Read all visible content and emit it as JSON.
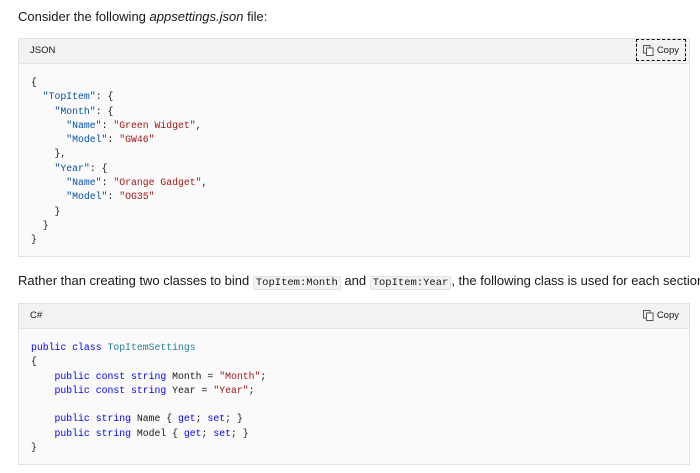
{
  "intro": {
    "prefix": "Consider the following ",
    "filename": "appsettings.json",
    "suffix": " file:"
  },
  "json_block": {
    "language": "JSON",
    "copy_label": "Copy",
    "lines": [
      "{",
      "  \"TopItem\": {",
      "    \"Month\": {",
      "      \"Name\": \"Green Widget\",",
      "      \"Model\": \"GW46\"",
      "    },",
      "    \"Year\": {",
      "      \"Name\": \"Orange Gadget\",",
      "      \"Model\": \"OG35\"",
      "    }",
      "  }",
      "}"
    ]
  },
  "middle": {
    "prefix": "Rather than creating two classes to bind ",
    "code1": "TopItem:Month",
    "and": " and ",
    "code2": "TopItem:Year",
    "suffix": ", the following class is used for each section:"
  },
  "csharp_block": {
    "language": "C#",
    "copy_label": "Copy",
    "lines": [
      "public class TopItemSettings",
      "{",
      "    public const string Month = \"Month\";",
      "    public const string Year = \"Year\";",
      "",
      "    public string Name { get; set; }",
      "    public string Model { get; set; }",
      "}"
    ]
  },
  "colors": {
    "string": "#a31515",
    "keyword": "#0000ff",
    "type": "#267f99",
    "code_background": "#fafafa",
    "header_background": "#f2f2f2"
  }
}
